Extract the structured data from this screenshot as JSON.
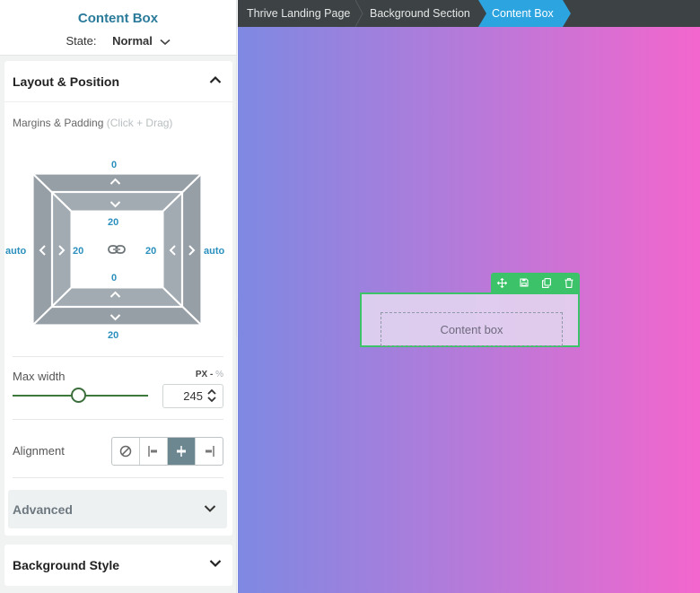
{
  "panel": {
    "title": "Content Box",
    "state_label": "State:",
    "state_value": "Normal"
  },
  "layout_section": {
    "title": "Layout & Position",
    "margins_label": "Margins & Padding",
    "margins_hint": "(Click + Drag)",
    "box_model": {
      "margin_top": "0",
      "margin_bottom": "20",
      "margin_left": "auto",
      "margin_right": "auto",
      "padding_top": "20",
      "padding_bottom": "0",
      "padding_left": "20",
      "padding_right": "20"
    },
    "max_width": {
      "label": "Max width",
      "unit_px": "PX",
      "unit_sep": "-",
      "unit_pct": "%",
      "value": "245",
      "slider_fraction": 0.49
    },
    "alignment": {
      "label": "Alignment",
      "options": [
        "none",
        "left",
        "center",
        "right"
      ],
      "selected": "center"
    },
    "advanced_label": "Advanced"
  },
  "background_section": {
    "title": "Background Style"
  },
  "breadcrumb": {
    "items": [
      "Thrive Landing Page",
      "Background Section",
      "Content Box"
    ],
    "active_color": "#2ba4e0"
  },
  "canvas": {
    "gradient_start": "#7e89e2",
    "gradient_end": "#f366cd",
    "element_text": "Content box",
    "toolbar_color": "#3cc36a",
    "toolbar_icons": [
      "move-icon",
      "save-icon",
      "duplicate-icon",
      "delete-icon"
    ]
  },
  "colors": {
    "accent": "#2a8fbd",
    "title": "#2a7a9a",
    "slider": "#3c7a3c"
  }
}
